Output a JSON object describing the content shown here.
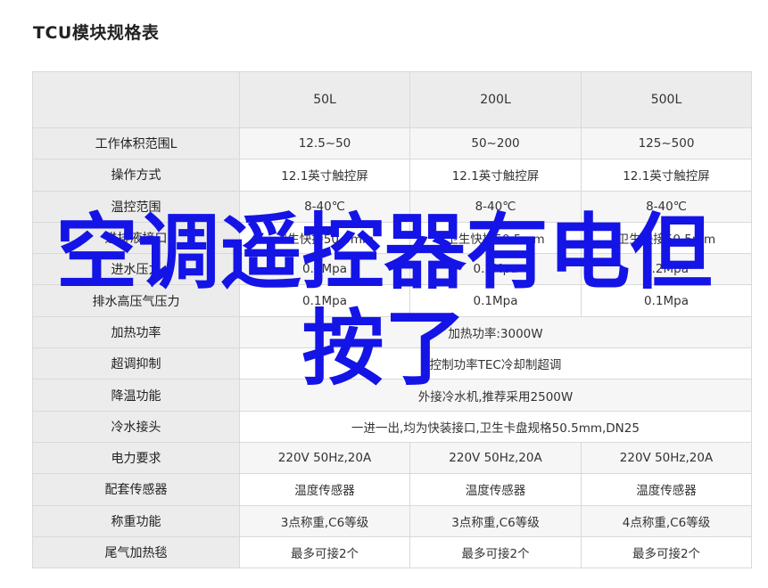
{
  "title": "TCU模块规格表",
  "table": {
    "corner": "",
    "columns": [
      "50L",
      "200L",
      "500L"
    ],
    "rows": [
      {
        "label": "工作体积范围L",
        "cells": [
          "12.5~50",
          "50~200",
          "125~500"
        ]
      },
      {
        "label": "操作方式",
        "cells": [
          "12.1英寸触控屏",
          "12.1英寸触控屏",
          "12.1英寸触控屏"
        ]
      },
      {
        "label": "温控范围",
        "cells": [
          "8-40℃",
          "8-40℃",
          "8-40℃"
        ]
      },
      {
        "label": "进排液接口",
        "cells": [
          "卫生快接50.5mm",
          "卫生快接50.5mm",
          "卫生快接50.5mm"
        ]
      },
      {
        "label": "进水压力",
        "cells": [
          "0.2Mpa",
          "0.2Mpa",
          "0.2Mpa"
        ]
      },
      {
        "label": "排水高压气压力",
        "cells": [
          "0.1Mpa",
          "0.1Mpa",
          "0.1Mpa"
        ]
      },
      {
        "label": "加热功率",
        "merged": "加热功率:3000W"
      },
      {
        "label": "超调抑制",
        "merged": "控制功率TEC冷却制超调"
      },
      {
        "label": "降温功能",
        "merged": "外接冷水机,推荐采用2500W"
      },
      {
        "label": "冷水接头",
        "merged": "一进一出,均为快装接口,卫生卡盘规格50.5mm,DN25"
      },
      {
        "label": "电力要求",
        "cells": [
          "220V 50Hz,20A",
          "220V 50Hz,20A",
          "220V 50Hz,20A"
        ]
      },
      {
        "label": "配套传感器",
        "cells": [
          "温度传感器",
          "温度传感器",
          "温度传感器"
        ]
      },
      {
        "label": "称重功能",
        "cells": [
          "3点称重,C6等级",
          "3点称重,C6等级",
          "4点称重,C6等级"
        ]
      },
      {
        "label": "尾气加热毯",
        "cells": [
          "最多可接2个",
          "最多可接2个",
          "最多可接2个"
        ]
      }
    ]
  },
  "overlay": {
    "line1": "空调遥控器有电但",
    "line2": "按了"
  },
  "colors": {
    "overlay": "#1414e6",
    "header_bg": "#ececec",
    "border": "#d9d9d9"
  }
}
